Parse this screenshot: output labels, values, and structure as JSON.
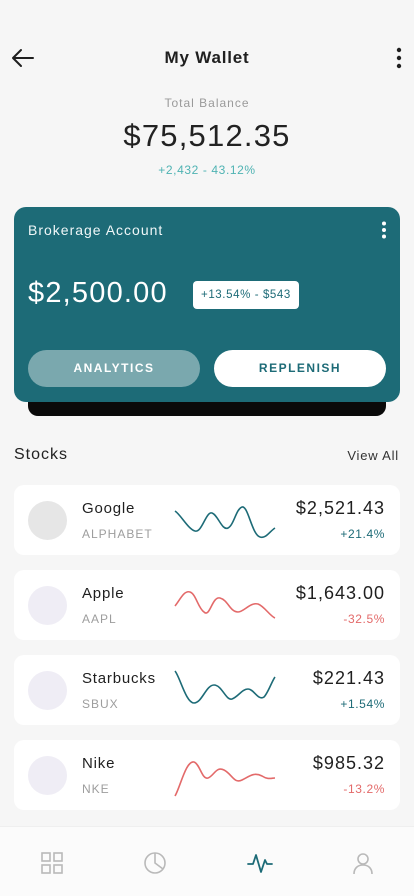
{
  "header": {
    "title": "My Wallet",
    "back_icon": "arrow-left-icon",
    "more_icon": "more-vertical-icon"
  },
  "balance": {
    "label": "Total Balance",
    "value": "$75,512.35",
    "change": "+2,432 - 43.12%"
  },
  "account_card": {
    "title": "Brokerage Account",
    "amount": "$2,500.00",
    "badge": "+13.54% - $543",
    "analytics_label": "ANALYTICS",
    "replenish_label": "REPLENISH",
    "color": "#1d6b77"
  },
  "stocks": {
    "title": "Stocks",
    "view_all": "View All",
    "items": [
      {
        "name": "Google",
        "ticker": "ALPHABET",
        "price": "$2,521.43",
        "change": "+21.4%",
        "trend": "positive"
      },
      {
        "name": "Apple",
        "ticker": "AAPL",
        "price": "$1,643.00",
        "change": "-32.5%",
        "trend": "negative"
      },
      {
        "name": "Starbucks",
        "ticker": "SBUX",
        "price": "$221.43",
        "change": "+1.54%",
        "trend": "positive"
      },
      {
        "name": "Nike",
        "ticker": "NKE",
        "price": "$985.32",
        "change": "-13.2%",
        "trend": "negative"
      }
    ]
  },
  "colors": {
    "positive": "#1d6b77",
    "negative": "#e36a6a",
    "accent": "#4fb3b3"
  },
  "tabbar": {
    "items": [
      "grid-icon",
      "pie-chart-icon",
      "activity-icon",
      "user-icon"
    ],
    "active": "activity-icon"
  }
}
